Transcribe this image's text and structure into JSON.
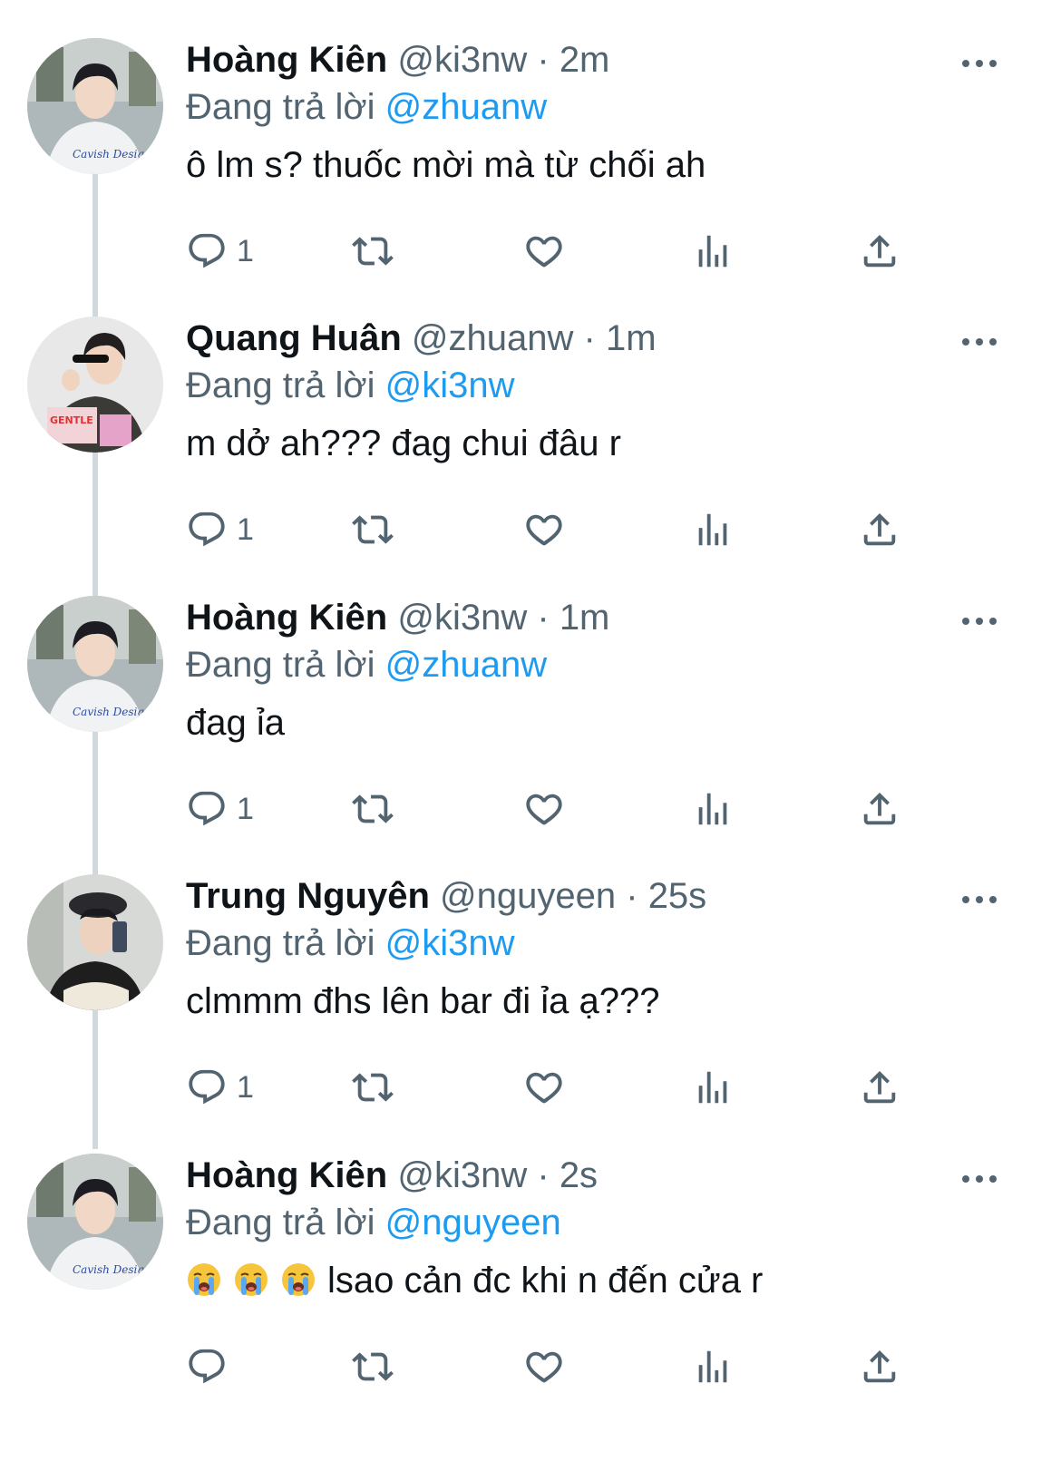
{
  "reply_prefix": "Đang trả lời",
  "tweets": [
    {
      "name": "Hoàng Kiên",
      "handle": "@ki3nw",
      "separator": "·",
      "time": "2m",
      "reply_to": "@zhuanw",
      "text": "ô lm s? thuốc mời mà từ chối ah",
      "reply_count": "1",
      "avatar": "kien"
    },
    {
      "name": "Quang Huân",
      "handle": "@zhuanw",
      "separator": "·",
      "time": "1m",
      "reply_to": "@ki3nw",
      "text": "m dở ah??? đag chui đâu r",
      "reply_count": "1",
      "avatar": "huan"
    },
    {
      "name": "Hoàng Kiên",
      "handle": "@ki3nw",
      "separator": "·",
      "time": "1m",
      "reply_to": "@zhuanw",
      "text": "đag ỉa",
      "reply_count": "1",
      "avatar": "kien"
    },
    {
      "name": "Trung Nguyên",
      "handle": "@nguyeen",
      "separator": "·",
      "time": "25s",
      "reply_to": "@ki3nw",
      "text": "clmmm đhs lên bar đi ỉa ạ???",
      "reply_count": "1",
      "avatar": "trung"
    },
    {
      "name": "Hoàng Kiên",
      "handle": "@ki3nw",
      "separator": "·",
      "time": "2s",
      "reply_to": "@nguyeen",
      "text": "lsao cản đc khi n đến cửa r",
      "emoji_prefix": [
        "loudly-crying-face",
        "loudly-crying-face",
        "loudly-crying-face"
      ],
      "reply_count": "",
      "avatar": "kien"
    }
  ],
  "colors": {
    "text": "#0f1419",
    "secondary": "#536471",
    "link": "#1d9bf0",
    "thread_line": "#cfd9de"
  },
  "icons": [
    "reply-icon",
    "retweet-icon",
    "like-icon",
    "views-icon",
    "share-icon",
    "more-icon"
  ]
}
